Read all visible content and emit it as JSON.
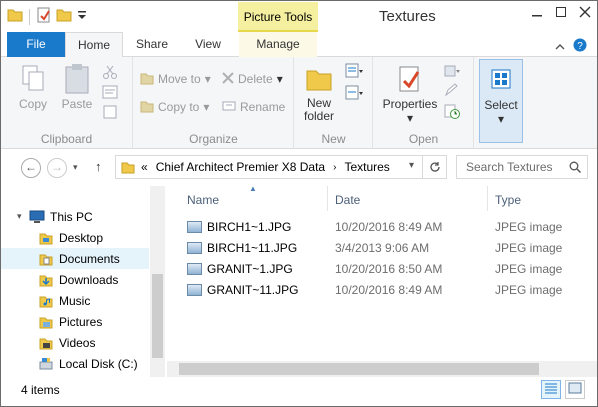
{
  "window": {
    "title": "Textures",
    "contextual_tab_group": "Picture Tools"
  },
  "tabs": [
    {
      "label": "File"
    },
    {
      "label": "Home"
    },
    {
      "label": "Share"
    },
    {
      "label": "View"
    },
    {
      "label": "Manage"
    }
  ],
  "ribbon": {
    "clipboard": {
      "label": "Clipboard",
      "copy": "Copy",
      "paste": "Paste"
    },
    "organize": {
      "label": "Organize",
      "move_to": "Move to",
      "copy_to": "Copy to",
      "delete": "Delete",
      "rename": "Rename"
    },
    "new": {
      "label": "New",
      "new_folder_line1": "New",
      "new_folder_line2": "folder"
    },
    "open": {
      "label": "Open",
      "properties": "Properties"
    },
    "select": {
      "label": "Select"
    }
  },
  "address": {
    "overflow": "«",
    "crumbs": [
      "Chief Architect Premier X8 Data",
      "Textures"
    ],
    "search_placeholder": "Search Textures"
  },
  "nav": {
    "items": [
      {
        "label": "This PC"
      },
      {
        "label": "Desktop"
      },
      {
        "label": "Documents"
      },
      {
        "label": "Downloads"
      },
      {
        "label": "Music"
      },
      {
        "label": "Pictures"
      },
      {
        "label": "Videos"
      },
      {
        "label": "Local Disk (C:)"
      }
    ]
  },
  "columns": {
    "name": "Name",
    "date": "Date",
    "type": "Type"
  },
  "files": [
    {
      "name": "BIRCH1~1.JPG",
      "date": "10/20/2016 8:49 AM",
      "type": "JPEG image"
    },
    {
      "name": "BIRCH1~11.JPG",
      "date": "3/4/2013 9:06 AM",
      "type": "JPEG image"
    },
    {
      "name": "GRANIT~1.JPG",
      "date": "10/20/2016 8:50 AM",
      "type": "JPEG image"
    },
    {
      "name": "GRANIT~11.JPG",
      "date": "10/20/2016 8:49 AM",
      "type": "JPEG image"
    }
  ],
  "status": {
    "item_count": "4 items"
  },
  "colors": {
    "file_tab": "#1979ca",
    "picture_tools": "#f5f0a0",
    "selection": "#e5f3fb"
  }
}
